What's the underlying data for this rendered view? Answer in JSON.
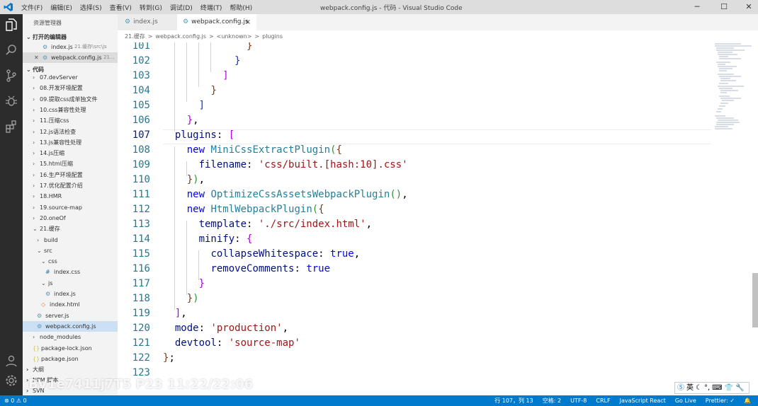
{
  "window": {
    "title": "webpack.config.js - 代码 - Visual Studio Code",
    "menu": [
      "文件(F)",
      "编辑(E)",
      "选择(S)",
      "查看(V)",
      "转到(G)",
      "调试(D)",
      "终端(T)",
      "帮助(H)"
    ],
    "controls": {
      "minimize": "─",
      "maximize": "☐",
      "close": "✕"
    }
  },
  "activity_bar": [
    "explorer-icon",
    "search-icon",
    "source-control-icon",
    "debug-icon",
    "extensions-icon",
    "account-icon",
    "settings-icon"
  ],
  "sidebar": {
    "title": "资源管理器",
    "open_editors": {
      "label": "打开的编辑器",
      "items": [
        {
          "name": "index.js",
          "path": "21.缓存\\src\\js"
        },
        {
          "name": "webpack.config.js",
          "path": "21..."
        }
      ]
    },
    "folder": {
      "label": "代码",
      "items": [
        {
          "label": "07.devServer",
          "depth": 1,
          "type": "folder",
          "open": false
        },
        {
          "label": "08.开发环境配置",
          "depth": 1,
          "type": "folder",
          "open": false
        },
        {
          "label": "09.提取css成单独文件",
          "depth": 1,
          "type": "folder",
          "open": false
        },
        {
          "label": "10.css兼容性处理",
          "depth": 1,
          "type": "folder",
          "open": false
        },
        {
          "label": "11.压缩css",
          "depth": 1,
          "type": "folder",
          "open": false
        },
        {
          "label": "12.js语法检查",
          "depth": 1,
          "type": "folder",
          "open": false
        },
        {
          "label": "13.js兼容性处理",
          "depth": 1,
          "type": "folder",
          "open": false
        },
        {
          "label": "14.js压缩",
          "depth": 1,
          "type": "folder",
          "open": false
        },
        {
          "label": "15.html压缩",
          "depth": 1,
          "type": "folder",
          "open": false
        },
        {
          "label": "16.生产环境配置",
          "depth": 1,
          "type": "folder",
          "open": false
        },
        {
          "label": "17.优化配置介绍",
          "depth": 1,
          "type": "folder",
          "open": false
        },
        {
          "label": "18.HMR",
          "depth": 1,
          "type": "folder",
          "open": false
        },
        {
          "label": "19.source-map",
          "depth": 1,
          "type": "folder",
          "open": false
        },
        {
          "label": "20.oneOf",
          "depth": 1,
          "type": "folder",
          "open": false
        },
        {
          "label": "21.缓存",
          "depth": 1,
          "type": "folder",
          "open": true
        },
        {
          "label": "build",
          "depth": 2,
          "type": "folder",
          "open": false
        },
        {
          "label": "src",
          "depth": 2,
          "type": "folder",
          "open": true
        },
        {
          "label": "css",
          "depth": 3,
          "type": "folder",
          "open": true
        },
        {
          "label": "index.css",
          "depth": 4,
          "type": "css"
        },
        {
          "label": "js",
          "depth": 3,
          "type": "folder",
          "open": true
        },
        {
          "label": "index.js",
          "depth": 4,
          "type": "js"
        },
        {
          "label": "index.html",
          "depth": 3,
          "type": "html"
        },
        {
          "label": "server.js",
          "depth": 2,
          "type": "js"
        },
        {
          "label": "webpack.config.js",
          "depth": 2,
          "type": "js",
          "selected": true
        },
        {
          "label": "node_modules",
          "depth": 1,
          "type": "folder",
          "open": false
        },
        {
          "label": "package-lock.json",
          "depth": 1,
          "type": "json"
        },
        {
          "label": "package.json",
          "depth": 1,
          "type": "json"
        }
      ]
    },
    "bottom_sections": [
      "大纲",
      "NPM 脚本",
      "SVN"
    ]
  },
  "tabs": [
    {
      "label": "index.js",
      "active": false
    },
    {
      "label": "webpack.config.js",
      "active": true,
      "close": "×"
    }
  ],
  "breadcrumb": [
    "21.缓存",
    ">",
    "webpack.config.js",
    ">",
    "<unknown>",
    ">",
    "plugins"
  ],
  "editor": {
    "lines": [
      {
        "n": "101",
        "tokens": [
          {
            "t": "              ",
            "c": ""
          },
          {
            "t": "}",
            "c": "t-br3"
          }
        ]
      },
      {
        "n": "102",
        "tokens": [
          {
            "t": "            ",
            "c": ""
          },
          {
            "t": "}",
            "c": "t-br1"
          }
        ]
      },
      {
        "n": "103",
        "tokens": [
          {
            "t": "          ",
            "c": ""
          },
          {
            "t": "]",
            "c": "t-pnk"
          }
        ]
      },
      {
        "n": "104",
        "tokens": [
          {
            "t": "        ",
            "c": ""
          },
          {
            "t": "}",
            "c": "t-br3"
          }
        ]
      },
      {
        "n": "105",
        "tokens": [
          {
            "t": "      ",
            "c": ""
          },
          {
            "t": "]",
            "c": "t-br1"
          }
        ]
      },
      {
        "n": "106",
        "tokens": [
          {
            "t": "    ",
            "c": ""
          },
          {
            "t": "}",
            "c": "t-pnk"
          },
          {
            "t": ",",
            "c": ""
          }
        ]
      },
      {
        "n": "107",
        "tokens": [
          {
            "t": "  ",
            "c": ""
          },
          {
            "t": "plugins",
            "c": "t-prop"
          },
          {
            "t": ": ",
            "c": ""
          },
          {
            "t": "[",
            "c": "t-pnk"
          }
        ]
      },
      {
        "n": "108",
        "tokens": [
          {
            "t": "    ",
            "c": ""
          },
          {
            "t": "new",
            "c": "t-kw"
          },
          {
            "t": " ",
            "c": ""
          },
          {
            "t": "MiniCssExtractPlugin",
            "c": "t-cls"
          },
          {
            "t": "(",
            "c": "t-br2"
          },
          {
            "t": "{",
            "c": "t-br3"
          }
        ]
      },
      {
        "n": "109",
        "tokens": [
          {
            "t": "      ",
            "c": ""
          },
          {
            "t": "filename",
            "c": "t-prop"
          },
          {
            "t": ": ",
            "c": ""
          },
          {
            "t": "'css/built.[hash:10].css'",
            "c": "t-str"
          }
        ]
      },
      {
        "n": "110",
        "tokens": [
          {
            "t": "    ",
            "c": ""
          },
          {
            "t": "}",
            "c": "t-br3"
          },
          {
            "t": ")",
            "c": "t-br2"
          },
          {
            "t": ",",
            "c": ""
          }
        ]
      },
      {
        "n": "111",
        "tokens": [
          {
            "t": "    ",
            "c": ""
          },
          {
            "t": "new",
            "c": "t-kw"
          },
          {
            "t": " ",
            "c": ""
          },
          {
            "t": "OptimizeCssAssetsWebpackPlugin",
            "c": "t-cls"
          },
          {
            "t": "()",
            "c": "t-br2"
          },
          {
            "t": ",",
            "c": ""
          }
        ]
      },
      {
        "n": "112",
        "tokens": [
          {
            "t": "    ",
            "c": ""
          },
          {
            "t": "new",
            "c": "t-kw"
          },
          {
            "t": " ",
            "c": ""
          },
          {
            "t": "HtmlWebpackPlugin",
            "c": "t-cls"
          },
          {
            "t": "(",
            "c": "t-br2"
          },
          {
            "t": "{",
            "c": "t-br3"
          }
        ]
      },
      {
        "n": "113",
        "tokens": [
          {
            "t": "      ",
            "c": ""
          },
          {
            "t": "template",
            "c": "t-prop"
          },
          {
            "t": ": ",
            "c": ""
          },
          {
            "t": "'./src/index.html'",
            "c": "t-str"
          },
          {
            "t": ",",
            "c": ""
          }
        ]
      },
      {
        "n": "114",
        "tokens": [
          {
            "t": "      ",
            "c": ""
          },
          {
            "t": "minify",
            "c": "t-prop"
          },
          {
            "t": ": ",
            "c": ""
          },
          {
            "t": "{",
            "c": "t-pnk"
          }
        ]
      },
      {
        "n": "115",
        "tokens": [
          {
            "t": "        ",
            "c": ""
          },
          {
            "t": "collapseWhitespace",
            "c": "t-prop"
          },
          {
            "t": ": ",
            "c": ""
          },
          {
            "t": "true",
            "c": "t-kw"
          },
          {
            "t": ",",
            "c": ""
          }
        ]
      },
      {
        "n": "116",
        "tokens": [
          {
            "t": "        ",
            "c": ""
          },
          {
            "t": "removeComments",
            "c": "t-prop"
          },
          {
            "t": ": ",
            "c": ""
          },
          {
            "t": "true",
            "c": "t-kw"
          }
        ]
      },
      {
        "n": "117",
        "tokens": [
          {
            "t": "      ",
            "c": ""
          },
          {
            "t": "}",
            "c": "t-pnk"
          }
        ]
      },
      {
        "n": "118",
        "tokens": [
          {
            "t": "    ",
            "c": ""
          },
          {
            "t": "}",
            "c": "t-br3"
          },
          {
            "t": ")",
            "c": "t-br2"
          }
        ]
      },
      {
        "n": "119",
        "tokens": [
          {
            "t": "  ",
            "c": ""
          },
          {
            "t": "]",
            "c": "t-pnk"
          },
          {
            "t": ",",
            "c": ""
          }
        ]
      },
      {
        "n": "120",
        "tokens": [
          {
            "t": "  ",
            "c": ""
          },
          {
            "t": "mode",
            "c": "t-prop"
          },
          {
            "t": ": ",
            "c": ""
          },
          {
            "t": "'production'",
            "c": "t-str"
          },
          {
            "t": ",",
            "c": ""
          }
        ]
      },
      {
        "n": "121",
        "tokens": [
          {
            "t": "  ",
            "c": ""
          },
          {
            "t": "devtool",
            "c": "t-prop"
          },
          {
            "t": ": ",
            "c": ""
          },
          {
            "t": "'source-map'",
            "c": "t-str"
          }
        ]
      },
      {
        "n": "122",
        "tokens": [
          {
            "t": "}",
            "c": "t-br3"
          },
          {
            "t": ";",
            "c": ""
          }
        ]
      },
      {
        "n": "123",
        "tokens": []
      }
    ]
  },
  "ime": [
    "英",
    "☾",
    "°,",
    "⌨",
    "👕",
    "🔧"
  ],
  "watermark": "BV1e7411j7T5 P23 11:22/22:06",
  "status": {
    "left": "⊗ 0  ⚠ 0",
    "right": [
      "行 107，列 13",
      "空格: 2",
      "UTF-8",
      "CRLF",
      "JavaScript React",
      "Go Live",
      "Prettier: ✓",
      "🔔"
    ]
  }
}
